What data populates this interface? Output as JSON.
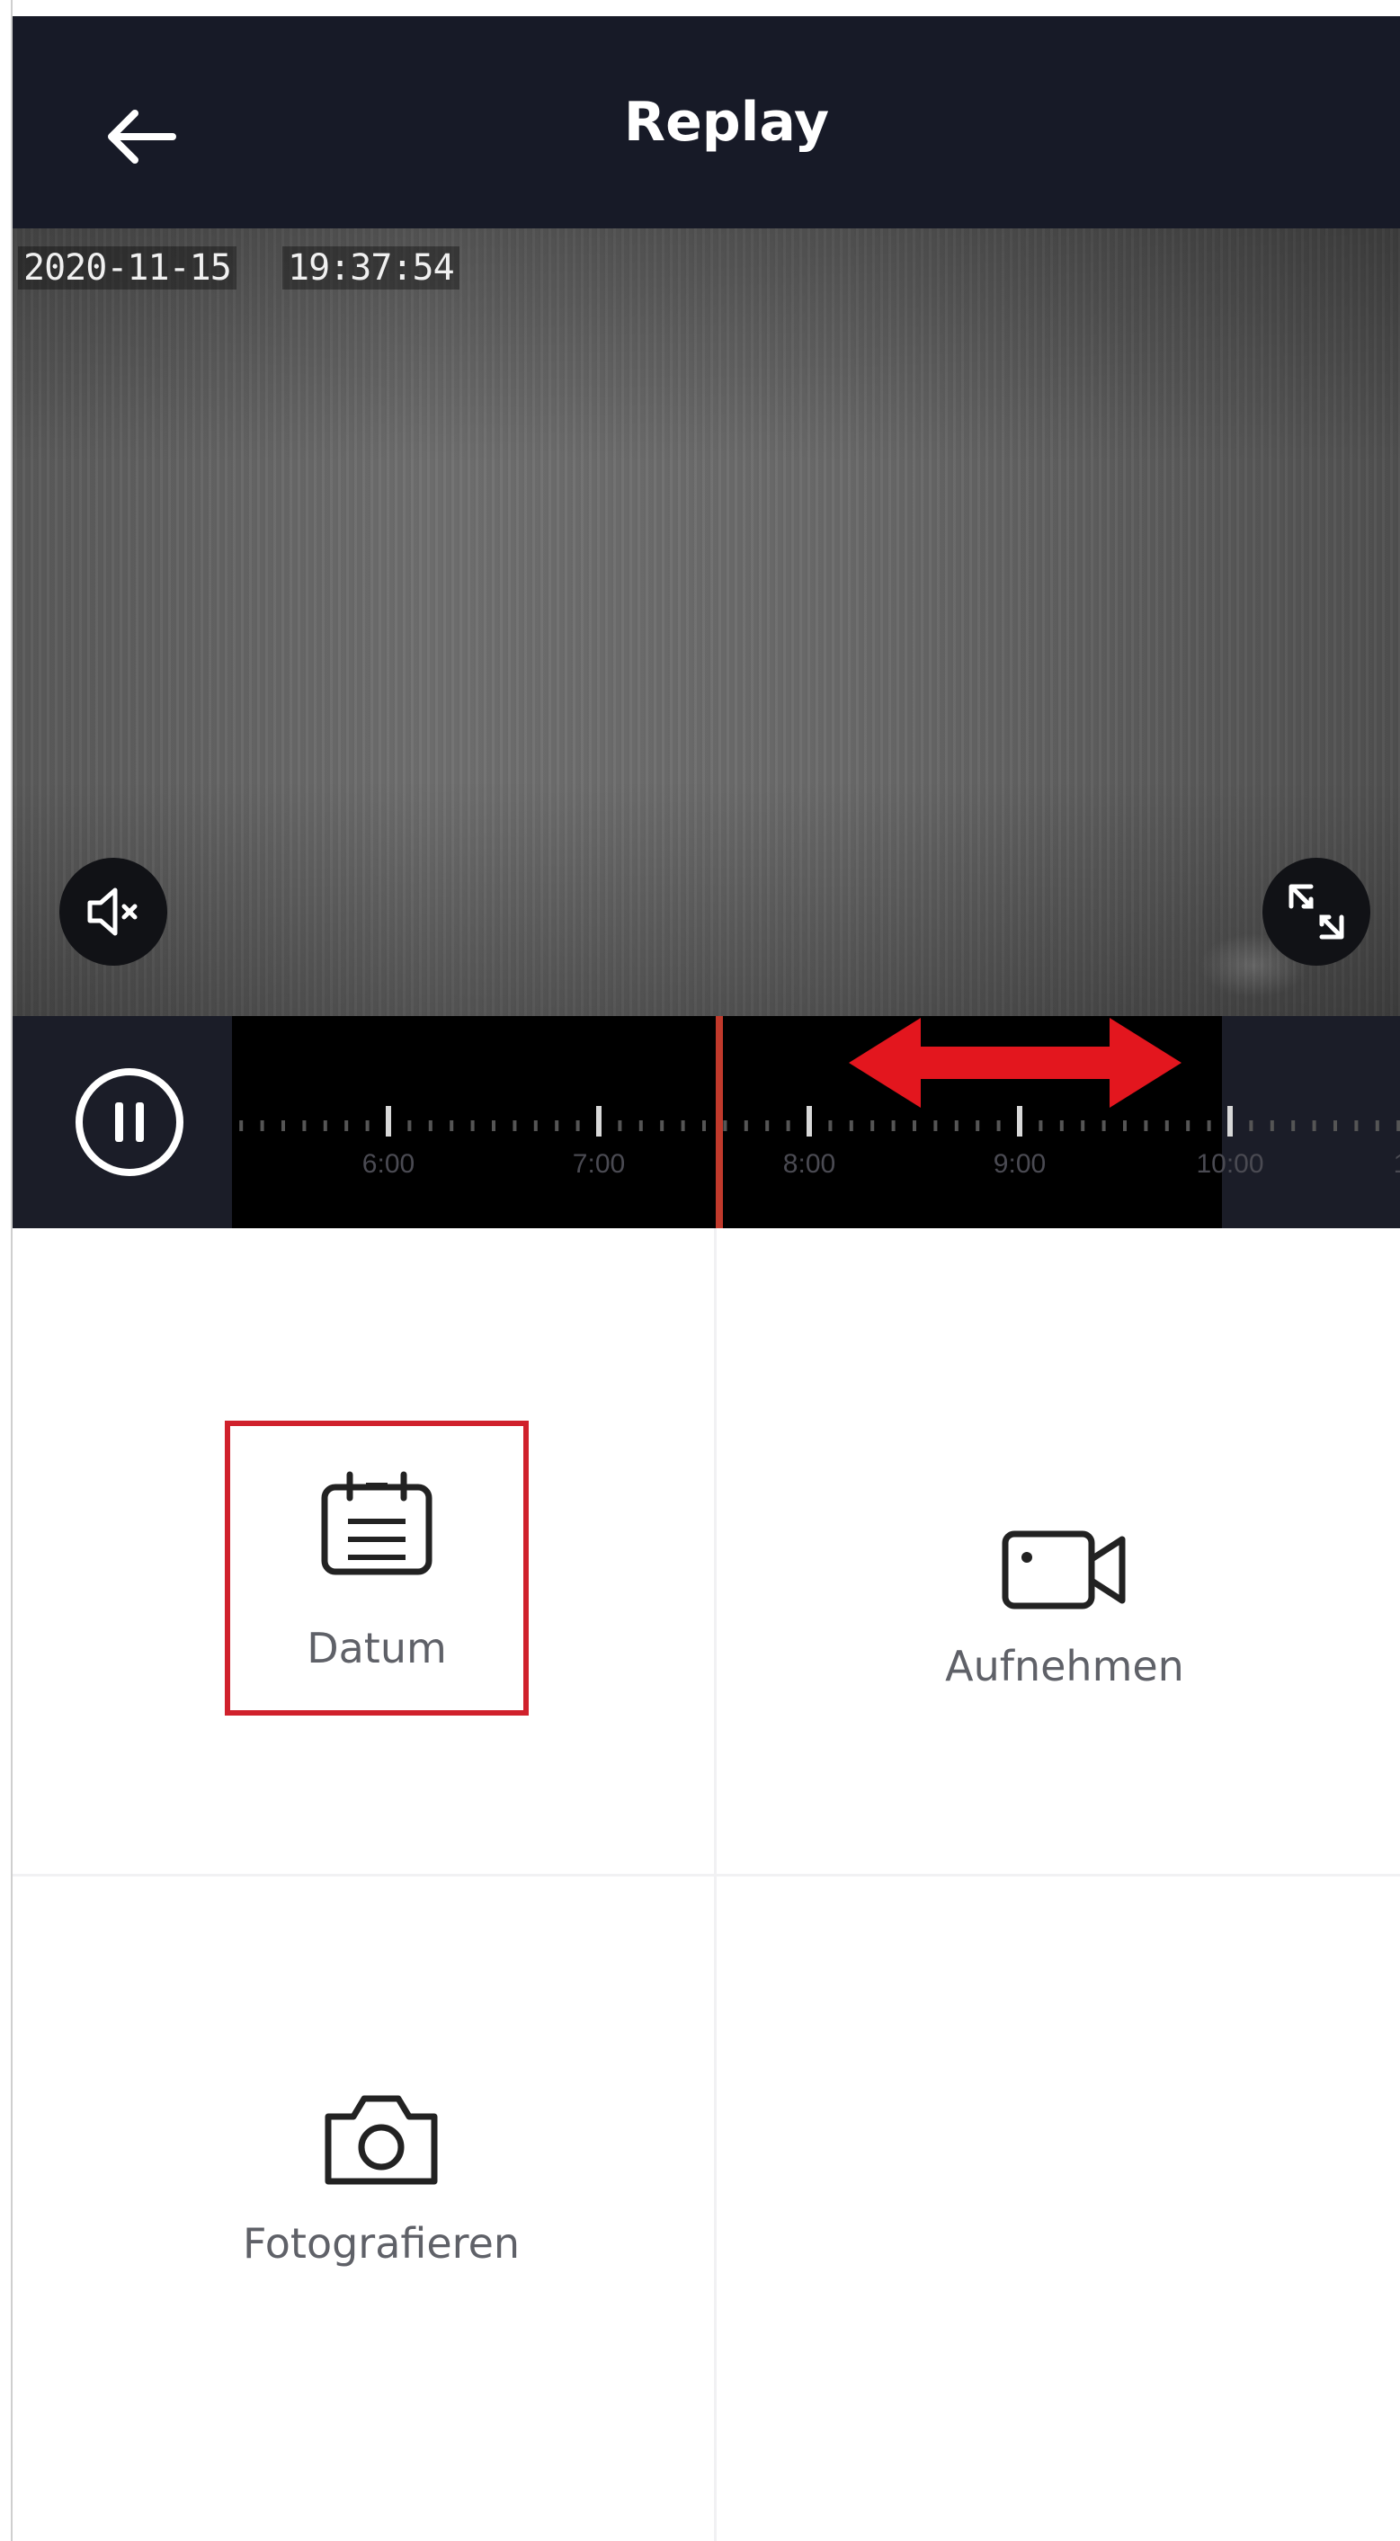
{
  "header": {
    "title": "Replay",
    "back_icon": "arrow-left-icon"
  },
  "video": {
    "date": "2020-11-15",
    "time": "19:37:54",
    "mute_icon": "speaker-muted-icon",
    "fullscreen_icon": "fullscreen-icon"
  },
  "timeline": {
    "pause_icon": "pause-icon",
    "ticks": [
      "6:00",
      "7:00",
      "8:00",
      "9:00",
      "10:00",
      "1"
    ],
    "playhead_color": "#c0392b",
    "arrow_color": "#e3161e"
  },
  "actions": {
    "datum": {
      "label": "Datum",
      "icon": "calendar-icon",
      "highlight_color": "#d0212c"
    },
    "record": {
      "label": "Aufnehmen",
      "icon": "video-camera-icon"
    },
    "photo": {
      "label": "Fotografieren",
      "icon": "camera-icon"
    }
  }
}
